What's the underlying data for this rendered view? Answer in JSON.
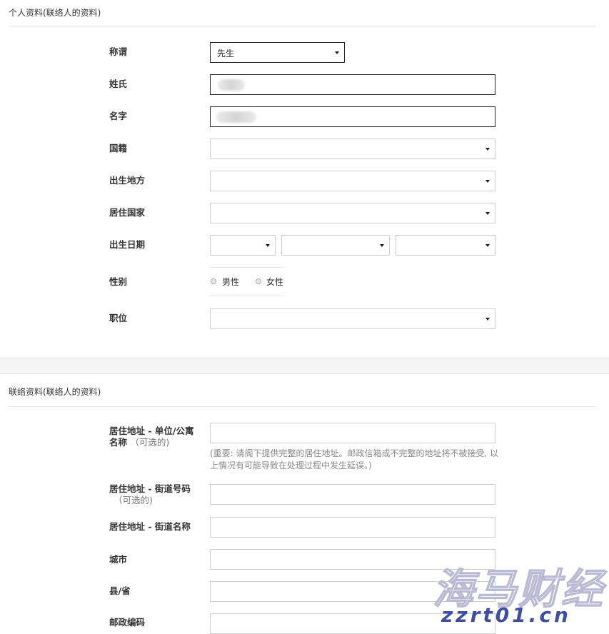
{
  "personal": {
    "title": "个人资料(联络人的资料)",
    "salutation": {
      "label": "称谓",
      "value": "先生"
    },
    "surname": {
      "label": "姓氏"
    },
    "given_name": {
      "label": "名字"
    },
    "nationality": {
      "label": "国籍",
      "value": ""
    },
    "birthplace": {
      "label": "出生地方",
      "value": ""
    },
    "residence_country": {
      "label": "居住国家",
      "value": ""
    },
    "dob": {
      "label": "出生日期",
      "day": "",
      "month": "",
      "year": ""
    },
    "gender": {
      "label": "性别",
      "options": [
        "男性",
        "女性"
      ]
    },
    "position": {
      "label": "职位",
      "value": ""
    }
  },
  "contact": {
    "title": "联络资料(联络人的资料)",
    "unit": {
      "label": "居住地址 - 单位/公寓名称",
      "optional": "（可选的)",
      "value": ""
    },
    "note": "(重要: 请阁下提供完整的居住地址。邮政信箱或不完整的地址将不被接受, 以上情况有可能导致在处理过程中发生延误。)",
    "street_no": {
      "label": "居住地址 - 街道号码",
      "optional": "（可选的)",
      "value": ""
    },
    "street_name": {
      "label": "居住地址 - 街道名称",
      "value": ""
    },
    "city": {
      "label": "城市",
      "value": ""
    },
    "county": {
      "label": "县/省",
      "value": ""
    },
    "postcode": {
      "label": "邮政编码",
      "value": ""
    }
  },
  "watermark": {
    "text": "海马财经",
    "url": "zzrt01.cn"
  }
}
